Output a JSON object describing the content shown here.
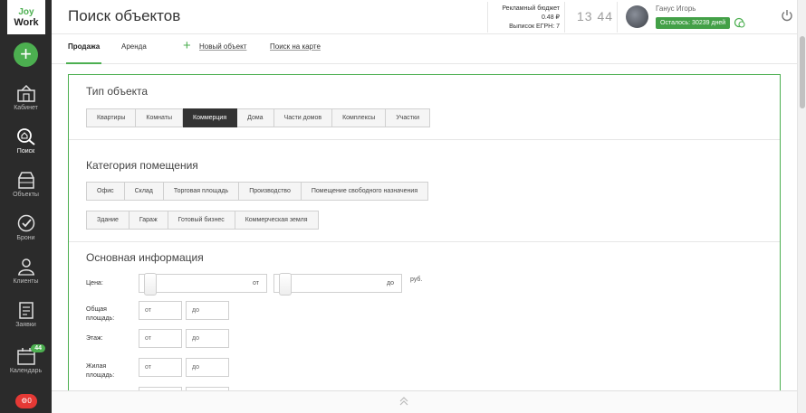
{
  "logo": {
    "line1": "Joy",
    "line2": "Work"
  },
  "sidebar": {
    "add_label": "+",
    "items": [
      {
        "label": "Кабинет",
        "icon": "cabinet-icon"
      },
      {
        "label": "Поиск",
        "icon": "search-icon"
      },
      {
        "label": "Объекты",
        "icon": "objects-icon"
      },
      {
        "label": "Брони",
        "icon": "check-circle-icon"
      },
      {
        "label": "Клиенты",
        "icon": "clients-icon"
      },
      {
        "label": "Заявки",
        "icon": "requests-icon"
      },
      {
        "label": "Календарь",
        "icon": "calendar-icon",
        "badge": "44"
      }
    ],
    "notifications_count": "0"
  },
  "header": {
    "title": "Поиск объектов",
    "budget_label": "Рекламный бюджет",
    "budget_value": "0.48 ₽",
    "egrn": "Выписок ЕГРН: 7",
    "time": "13 44",
    "user_name": "Ганус Игорь",
    "remaining": "Осталось: 30239 дней"
  },
  "tabs": {
    "sale": "Продажа",
    "rent": "Аренда",
    "new_object": "Новый объект",
    "map_search": "Поиск на карте"
  },
  "object_type": {
    "title": "Тип объекта",
    "options": [
      "Квартиры",
      "Комнаты",
      "Коммерция",
      "Дома",
      "Части домов",
      "Комплексы",
      "Участки"
    ],
    "selected": "Коммерция"
  },
  "category": {
    "title": "Категория помещения",
    "row1": [
      "Офис",
      "Склад",
      "Торговая площадь",
      "Производство",
      "Помещение свободного назначения"
    ],
    "row2": [
      "Здание",
      "Гараж",
      "Готовый бизнес",
      "Коммерческая земля"
    ]
  },
  "main_info": {
    "title": "Основная информация",
    "price_label": "Цена:",
    "price_from": "от",
    "price_to": "до",
    "currency": "руб.",
    "total_area_label": "Общая площадь:",
    "floor_label": "Этаж:",
    "living_area_label": "Жилая площадь:",
    "from_placeholder": "от",
    "to_placeholder": "до"
  },
  "colors": {
    "accent": "#4caf50",
    "sidebar": "#2b2b2b",
    "selected": "#333333",
    "alert": "#e53935"
  }
}
